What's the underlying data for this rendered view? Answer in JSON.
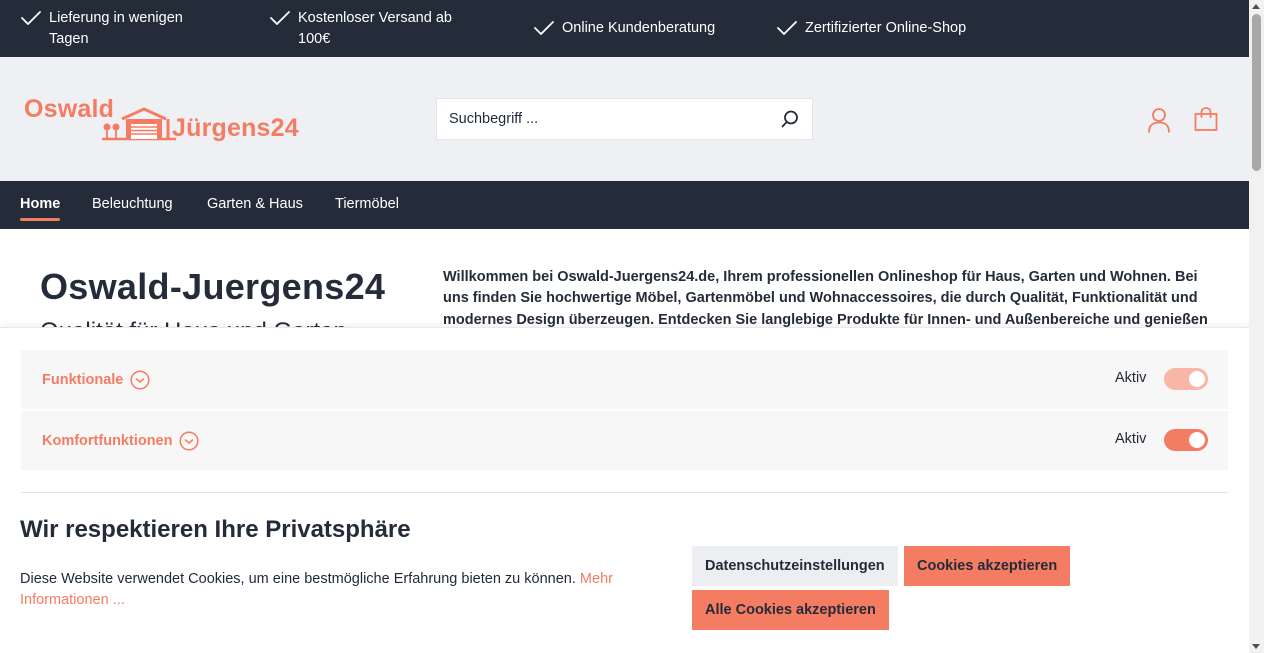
{
  "usp": [
    {
      "line1": "Lieferung in wenigen",
      "line2": "Tagen"
    },
    {
      "line1": "Kostenloser Versand ab",
      "line2": "100€"
    },
    {
      "line1": "Online Kundenberatung",
      "line2": ""
    },
    {
      "line1": "Zertifizierter Online-Shop",
      "line2": ""
    }
  ],
  "logo": {
    "part1": "Oswald",
    "part2": "Jürgens24"
  },
  "search": {
    "placeholder": "Suchbegriff ..."
  },
  "icons": {
    "user": "user-icon",
    "cart": "shopping-bag-icon",
    "search": "search-icon",
    "check": "check-icon"
  },
  "nav": [
    "Home",
    "Beleuchtung",
    "Garten & Haus",
    "Tiermöbel"
  ],
  "hero": {
    "title": "Oswald-Juergens24",
    "subtitle": "Qualität für Haus und Garten",
    "text": "Willkommen bei Oswald-Juergens24.de, Ihrem professionellen Onlineshop für Haus, Garten und Wohnen. Bei uns finden Sie hochwertige Möbel, Gartenmöbel und Wohnaccessoires, die durch Qualität, Funktionalität und modernes Design überzeugen. Entdecken Sie langlebige Produkte für Innen- und Außenbereiche und genießen"
  },
  "cookie": {
    "rows": [
      {
        "label": "Funktionale",
        "status": "Aktiv",
        "enabled": true,
        "locked": true
      },
      {
        "label": "Komfortfunktionen",
        "status": "Aktiv",
        "enabled": true,
        "locked": false
      }
    ],
    "title": "Wir respektieren Ihre Privatsphäre",
    "text": "Diese Website verwendet Cookies, um eine bestmögliche Erfahrung bieten zu können. ",
    "more_link": "Mehr Informationen ...",
    "buttons": {
      "settings": "Datenschutzeinstellungen",
      "accept": "Cookies akzeptieren",
      "accept_all": "Alle Cookies akzeptieren"
    }
  },
  "colors": {
    "accent": "#f47c62",
    "dark": "#242c3a",
    "header_bg": "#eff0f4"
  }
}
